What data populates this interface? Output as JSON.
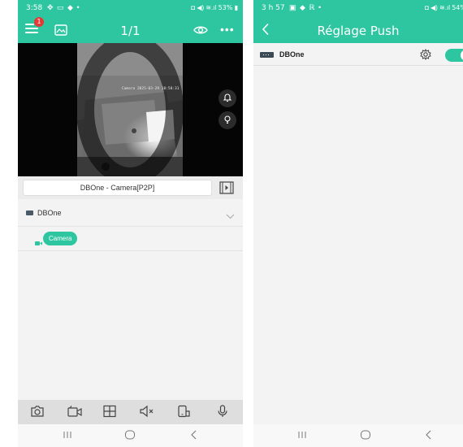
{
  "left_screen": {
    "status_bar": {
      "time": "3:58",
      "left_icons": "✥ ▭ ◆ •",
      "right_icons": "◘ ◀) ≋.ıl",
      "battery": "53%"
    },
    "header": {
      "notification_badge": "1",
      "page_indicator": "1/1"
    },
    "video": {
      "overlay_text": "Camera  2025-03-29 18:58:31"
    },
    "device_bar": {
      "title": "DBOne - Camera[P2P]"
    },
    "device_list": {
      "device_name": "DBOne",
      "camera_label": "Camera"
    },
    "toolbar": {
      "icons": [
        "camera-icon",
        "record-icon",
        "grid-icon",
        "mute-icon",
        "phone-icon",
        "microphone-icon"
      ]
    }
  },
  "right_screen": {
    "status_bar": {
      "time": "3 h 57",
      "left_icons": "▣ ◆ ℝ •",
      "right_icons": "◘ ◀) ≋.ıl",
      "battery": "54%"
    },
    "header": {
      "title": "Réglage Push"
    },
    "push_list": {
      "device_name": "DBOne",
      "push_enabled": true
    }
  },
  "colors": {
    "accent": "#2dc6a0",
    "badge": "#e53935",
    "background": "#f3f3f3"
  }
}
